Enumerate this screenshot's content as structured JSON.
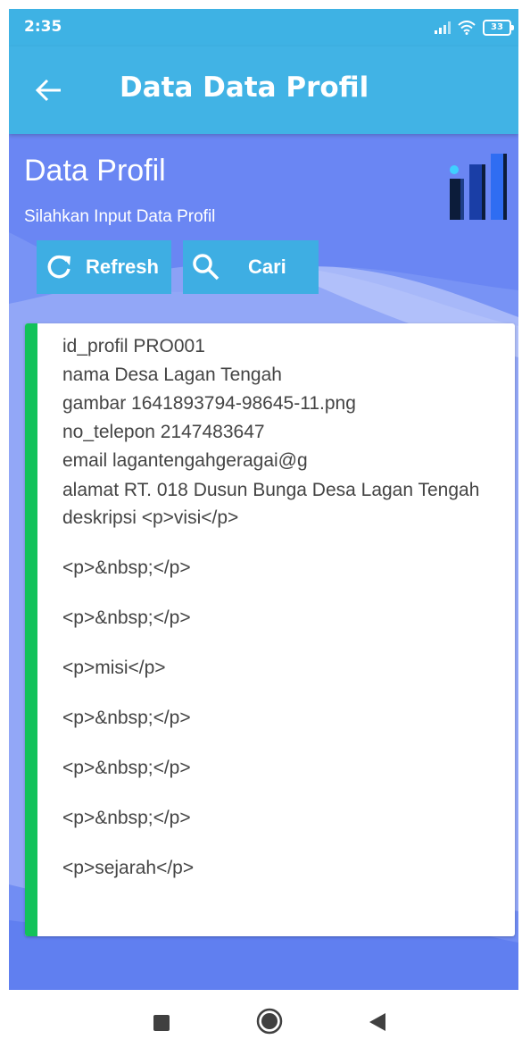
{
  "status_bar": {
    "time": "2:35",
    "battery": "33",
    "icons": [
      "signal-icon",
      "wifi-icon",
      "battery-icon"
    ]
  },
  "app_bar": {
    "title": "Data Data Profil",
    "back_icon": "arrow-left-icon",
    "color": "#41b3e5"
  },
  "header": {
    "title": "Data Profil",
    "subtitle": "Silahkan Input Data Profil",
    "logo_icon": "bar-chart-3d-icon"
  },
  "buttons": {
    "refresh_label": "Refresh",
    "refresh_icon": "refresh-icon",
    "search_label": "Cari",
    "search_icon": "search-icon",
    "color": "#3eaee3"
  },
  "profile": {
    "id_profil": "id_profil PRO001",
    "nama": "nama Desa Lagan Tengah",
    "gambar": "gambar 1641893794-98645-11.png",
    "no_telepon": "no_telepon 2147483647",
    "email": "email lagantengahgeragai@g",
    "alamat": "alamat RT. 018 Dusun Bunga Desa Lagan Tengah",
    "deskripsi": "deskripsi <p>visi</p>",
    "deskripsi_lines": [
      "<p>&nbsp;</p>",
      "<p>&nbsp;</p>",
      "<p>misi</p>",
      "<p>&nbsp;</p>",
      "<p>&nbsp;</p>",
      "<p>&nbsp;</p>",
      "<p>sejarah</p>"
    ]
  },
  "colors": {
    "background": "#6a86f3",
    "accent": "#12c25a",
    "text": "#444444"
  },
  "nav_bar": {
    "icons": [
      "recents-icon",
      "home-icon",
      "back-icon"
    ]
  }
}
